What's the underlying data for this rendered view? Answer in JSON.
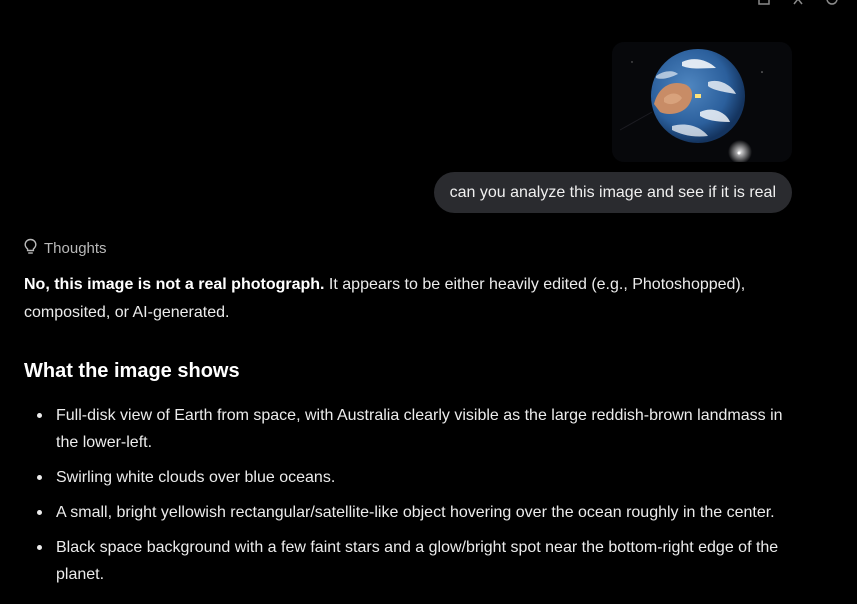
{
  "message": {
    "user_text": "can you analyze this image and see if it is real",
    "attached_image": "earth-from-space"
  },
  "response": {
    "thoughts_label": "Thoughts",
    "intro_bold": "No, this image is not a real photograph.",
    "intro_rest": " It appears to be either heavily edited (e.g., Photoshopped), composited, or AI-generated.",
    "section_title": "What the image shows",
    "bullets": [
      "Full-disk view of Earth from space, with Australia clearly visible as the large reddish-brown landmass in the lower-left.",
      "Swirling white clouds over blue oceans.",
      "A small, bright yellowish rectangular/satellite-like object hovering over the ocean roughly in the center.",
      "Black space background with a few faint stars and a glow/bright spot near the bottom-right edge of the planet."
    ]
  },
  "icons": {
    "thoughts": "lightbulb-icon",
    "toolbar": [
      "copy-icon",
      "pin-icon",
      "settings-icon"
    ]
  }
}
